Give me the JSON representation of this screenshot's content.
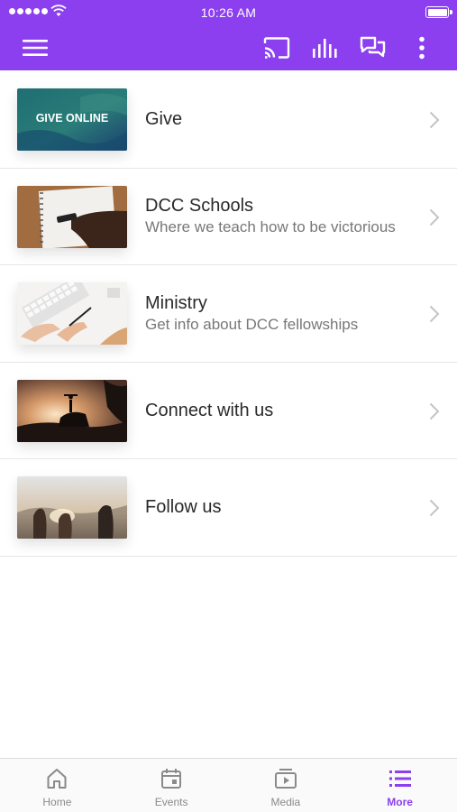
{
  "status_bar": {
    "time": "10:26 AM"
  },
  "app_bar": {
    "icons": [
      "menu-icon",
      "cast-icon",
      "stats-icon",
      "chat-icon",
      "more-vertical-icon"
    ]
  },
  "list": {
    "items": [
      {
        "title": "Give",
        "subtitle": "",
        "thumb_text": "GIVE ONLINE",
        "thumb_icon": "give-online-image"
      },
      {
        "title": "DCC Schools",
        "subtitle": "Where we teach how to be victorious",
        "thumb_icon": "notebook-writing-image"
      },
      {
        "title": "Ministry",
        "subtitle": "Get info about DCC fellowships",
        "thumb_icon": "desk-keyboard-image"
      },
      {
        "title": "Connect with us",
        "subtitle": "",
        "thumb_icon": "sunset-silhouette-image"
      },
      {
        "title": "Follow us",
        "subtitle": "",
        "thumb_icon": "friends-sunset-image"
      }
    ]
  },
  "tab_bar": {
    "tabs": [
      {
        "label": "Home",
        "icon": "home-icon",
        "active": false
      },
      {
        "label": "Events",
        "icon": "calendar-icon",
        "active": false
      },
      {
        "label": "Media",
        "icon": "media-play-icon",
        "active": false
      },
      {
        "label": "More",
        "icon": "list-icon",
        "active": true
      }
    ]
  },
  "colors": {
    "accent": "#8b3fef",
    "inactive": "#8a8a8a"
  }
}
